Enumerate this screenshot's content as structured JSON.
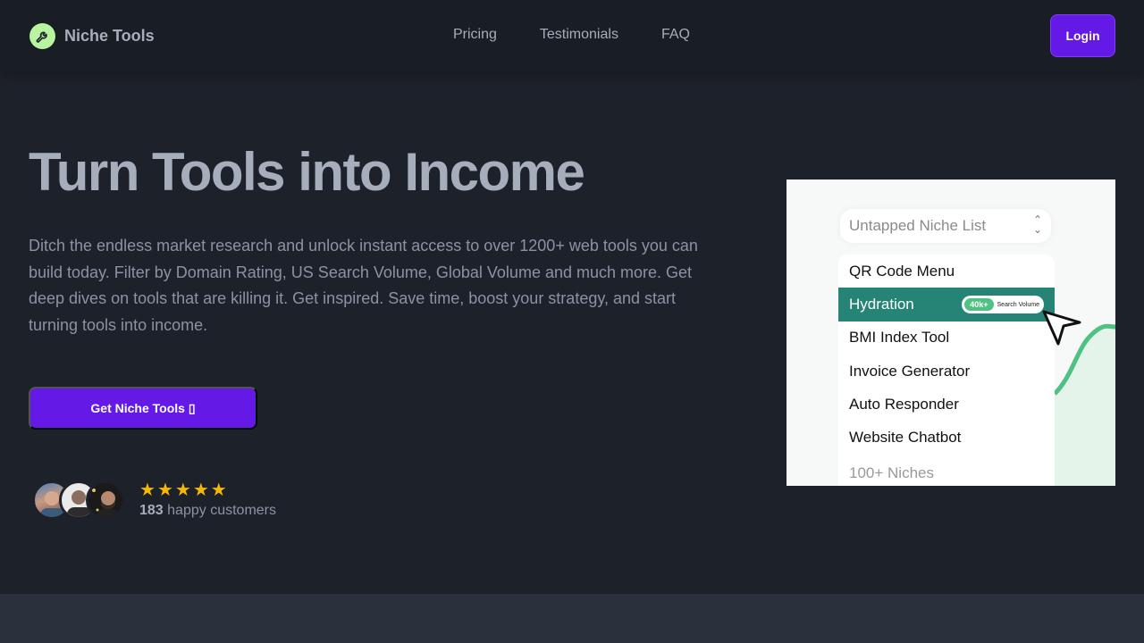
{
  "header": {
    "brand": "Niche Tools",
    "nav": [
      "Pricing",
      "Testimonials",
      "FAQ"
    ],
    "login_label": "Login"
  },
  "hero": {
    "title": "Turn Tools into Income",
    "description": "Ditch the endless market research and unlock instant access to over 1200+ web tools you can build today. Filter by Domain Rating, US Search Volume, Global Volume and much more. Get deep dives on tools that are killing it. Get inspired. Save time, boost your strategy, and start turning tools into income.",
    "cta_label": "Get Niche Tools ▯",
    "rating_stars": 5,
    "customers_count": "183",
    "customers_label": "happy customers"
  },
  "card": {
    "select_label": "Untapped Niche List",
    "items": [
      "QR Code Menu",
      "Hydration",
      "BMI Index Tool",
      "Invoice Generator",
      "Auto Responder",
      "Website Chatbot",
      "100+ Niches"
    ],
    "active_index": 1,
    "badge_value": "40k+",
    "badge_label": "Search Volume"
  },
  "colors": {
    "accent": "#6419e6",
    "background": "#1d212a",
    "header_bg": "#191d24",
    "star": "#f5b70a",
    "teal": "#268476"
  }
}
